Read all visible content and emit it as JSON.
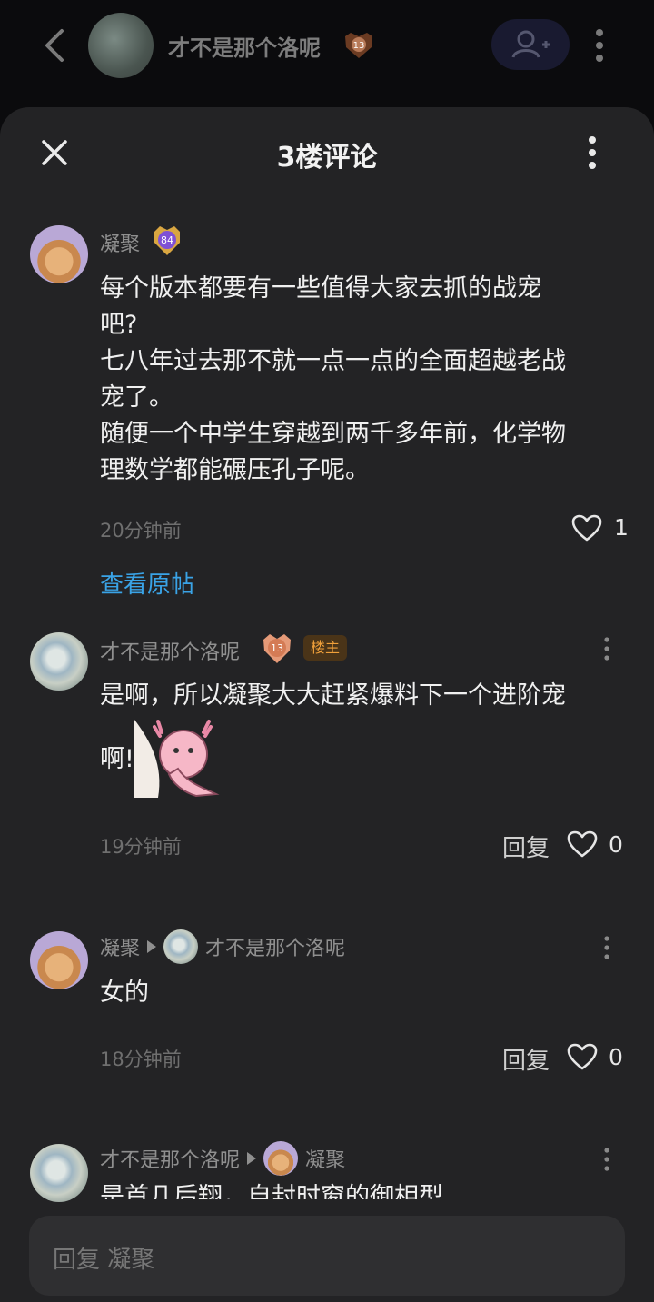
{
  "top": {
    "name": "才不是那个洛呢",
    "level": "13"
  },
  "sheet": {
    "title": "3楼评论"
  },
  "main_comment": {
    "user": "凝聚",
    "level": "84",
    "lines": [
      "每个版本都要有一些值得大家去抓的战宠",
      "吧?",
      "七八年过去那不就一点一点的全面超越老战",
      "宠了。",
      "随便一个中学生穿越到两千多年前，化学物",
      "理数学都能碾压孔子呢。"
    ],
    "time": "20分钟前",
    "likes": "1",
    "view_original": "查看原帖"
  },
  "replies": [
    {
      "user": "才不是那个洛呢",
      "level": "13",
      "owner_tag": "楼主",
      "line1": "是啊，所以凝聚大大赶紧爆料下一个进阶宠",
      "line2": "啊!",
      "time": "19分钟前",
      "reply_label": "回复",
      "likes": "0"
    },
    {
      "user": "凝聚",
      "reply_to": "才不是那个洛呢",
      "text": "女的",
      "time": "18分钟前",
      "reply_label": "回复",
      "likes": "0"
    },
    {
      "user": "才不是那个洛呢",
      "reply_to": "凝聚",
      "partial_text": "是首几后翔，自封时窗的御相型"
    }
  ],
  "input": {
    "placeholder": "回复 凝聚"
  },
  "colors": {
    "sheet_bg": "#232325",
    "link": "#3aa3e6",
    "owner_tag": "#f0a03a"
  }
}
